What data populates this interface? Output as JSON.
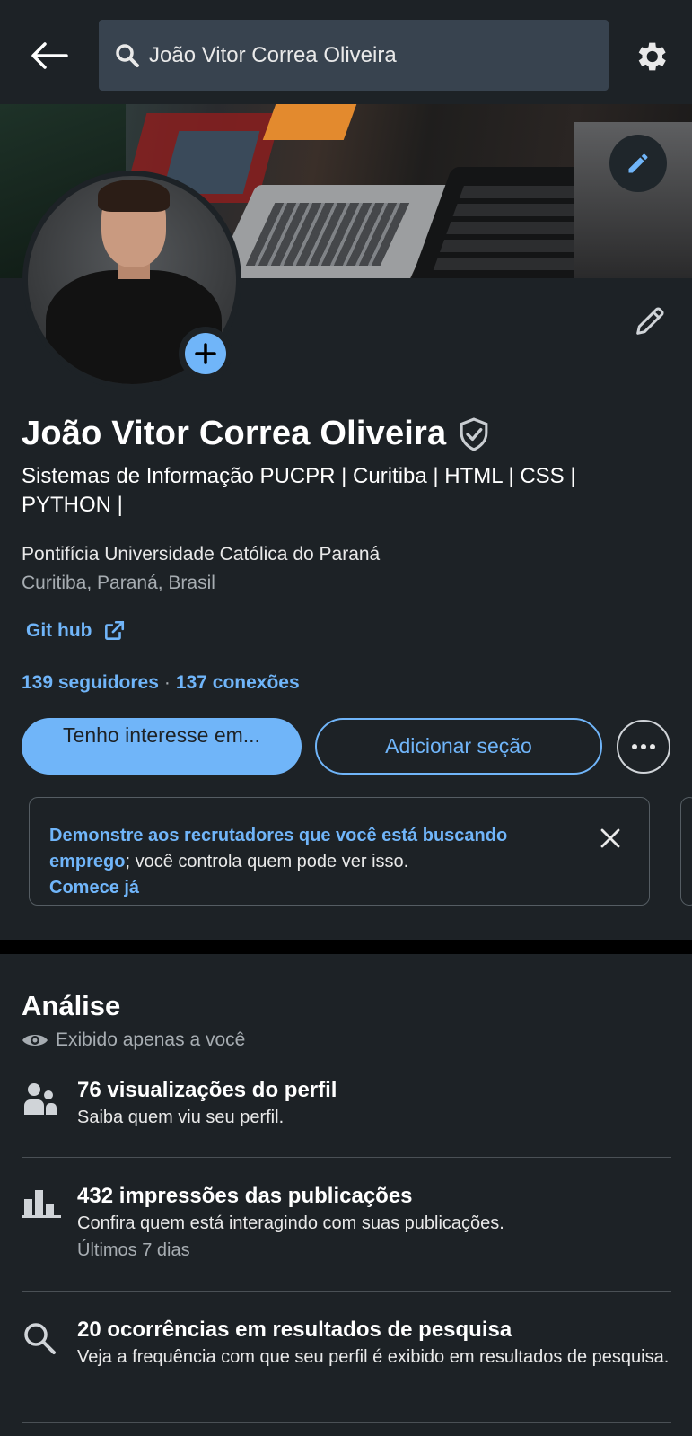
{
  "header": {
    "search_value": "João Vitor Correa Oliveira"
  },
  "profile": {
    "name": "João Vitor Correa Oliveira",
    "headline": "Sistemas de Informação  PUCPR | Curitiba | HTML | CSS | PYTHON |",
    "school": "Pontifícia Universidade Católica do Paraná",
    "location": "Curitiba, Paraná, Brasil",
    "link_label": "Git hub",
    "followers": "139 seguidores",
    "separator": "·",
    "connections": "137 conexões"
  },
  "actions": {
    "primary_label": "Tenho interesse em...",
    "secondary_label": "Adicionar seção"
  },
  "recruiter_card": {
    "highlight": "Demonstre aos recrutadores que você está buscando emprego",
    "rest": "; você controla quem pode ver isso.",
    "cta": "Comece já"
  },
  "analytics": {
    "title": "Análise",
    "private_note": "Exibido apenas a você",
    "items": [
      {
        "icon": "people-icon",
        "title": "76 visualizações do perfil",
        "desc": "Saiba quem viu seu perfil.",
        "sub": ""
      },
      {
        "icon": "bar-chart-icon",
        "title": "432 impressões das publicações",
        "desc": "Confira quem está interagindo com suas publicações.",
        "sub": "Últimos 7 dias"
      },
      {
        "icon": "search-icon",
        "title": "20 ocorrências em resultados de pesquisa",
        "desc": "Veja a frequência com que seu perfil é exibido em resultados de pesquisa.",
        "sub": ""
      }
    ]
  },
  "colors": {
    "background": "#1d2226",
    "accent": "#70b5f9",
    "search_bg": "#38434f"
  }
}
